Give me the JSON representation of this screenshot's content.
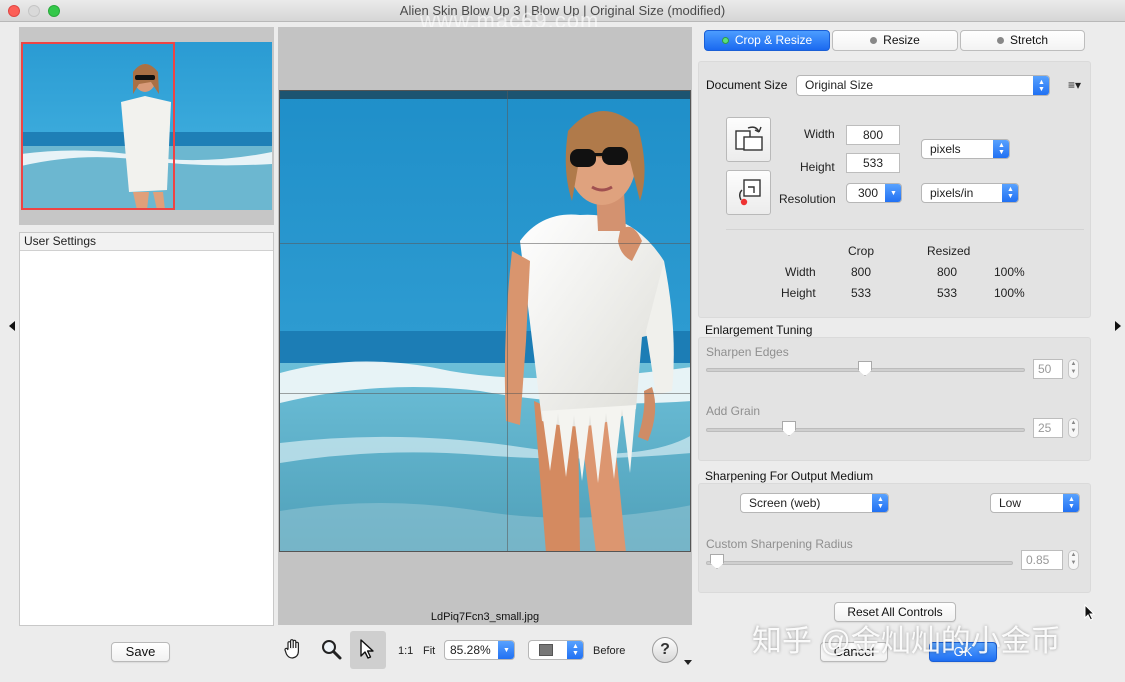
{
  "window": {
    "title": "Alien Skin Blow Up 3 | Blow Up | Original Size (modified)"
  },
  "left": {
    "settings_title": "User Settings",
    "save_label": "Save"
  },
  "preview": {
    "filename": "LdPiq7Fcn3_small.jpg"
  },
  "toolbar": {
    "one_to_one": "1:1",
    "fit": "Fit",
    "zoom_value": "85.28%",
    "before_label": "Before"
  },
  "tabs": [
    {
      "label": "Crop & Resize",
      "active": true
    },
    {
      "label": "Resize",
      "active": false
    },
    {
      "label": "Stretch",
      "active": false
    }
  ],
  "doc": {
    "size_label": "Document Size",
    "size_value": "Original Size",
    "width_label": "Width",
    "width_value": "800",
    "height_label": "Height",
    "height_value": "533",
    "units": "pixels",
    "resolution_label": "Resolution",
    "resolution_value": "300",
    "resolution_units": "pixels/in",
    "table": {
      "col_crop": "Crop",
      "col_resized": "Resized",
      "rows": [
        {
          "label": "Width",
          "crop": "800",
          "resized": "800",
          "pct": "100%"
        },
        {
          "label": "Height",
          "crop": "533",
          "resized": "533",
          "pct": "100%"
        }
      ]
    }
  },
  "tuning": {
    "title": "Enlargement Tuning",
    "sharpen_label": "Sharpen Edges",
    "sharpen_value": "50",
    "grain_label": "Add Grain",
    "grain_value": "25"
  },
  "sharpening": {
    "title": "Sharpening For Output Medium",
    "medium_value": "Screen (web)",
    "amount_value": "Low",
    "radius_label": "Custom Sharpening Radius",
    "radius_value": "0.85"
  },
  "buttons": {
    "reset": "Reset All Controls",
    "cancel": "Cancel",
    "ok": "OK"
  },
  "watermarks": {
    "top": "www.mac69.com",
    "bottom": "知乎 @金灿灿的小金币"
  },
  "colors": {
    "accent": "#1e6ef2",
    "nav_rect": "#e44444"
  }
}
